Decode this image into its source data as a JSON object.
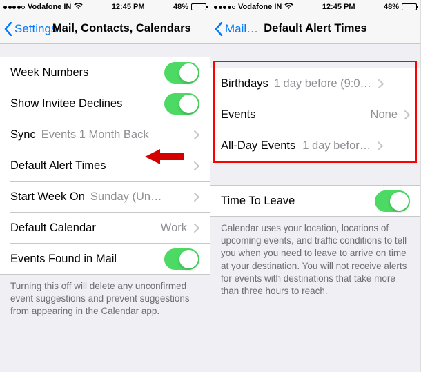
{
  "status": {
    "carrier": "Vodafone IN",
    "time": "12:45 PM",
    "battery_pct": "48%"
  },
  "left": {
    "back_label": "Settings",
    "title": "Mail, Contacts, Calendars",
    "rows": {
      "week_numbers": "Week Numbers",
      "show_invitee": "Show Invitee Declines",
      "sync": "Sync",
      "sync_value": "Events 1 Month Back",
      "default_alert": "Default Alert Times",
      "start_week": "Start Week On",
      "start_week_value": "Sunday (Un…",
      "default_cal": "Default Calendar",
      "default_cal_value": "Work",
      "events_mail": "Events Found in Mail"
    },
    "footer": "Turning this off will delete any unconfirmed event suggestions and prevent suggestions from appearing in the Calendar app."
  },
  "right": {
    "back_label": "Mail…",
    "title": "Default Alert Times",
    "rows": {
      "birthdays": "Birthdays",
      "birthdays_value": "1 day before (9:0…",
      "events": "Events",
      "events_value": "None",
      "allday": "All-Day Events",
      "allday_value": "1 day befor…",
      "time_to_leave": "Time To Leave"
    },
    "footer": "Calendar uses your location, locations of upcoming events, and traffic conditions to tell you when you need to leave to arrive on time at your destination. You will not receive alerts for events with destinations that take more than three hours to reach."
  }
}
